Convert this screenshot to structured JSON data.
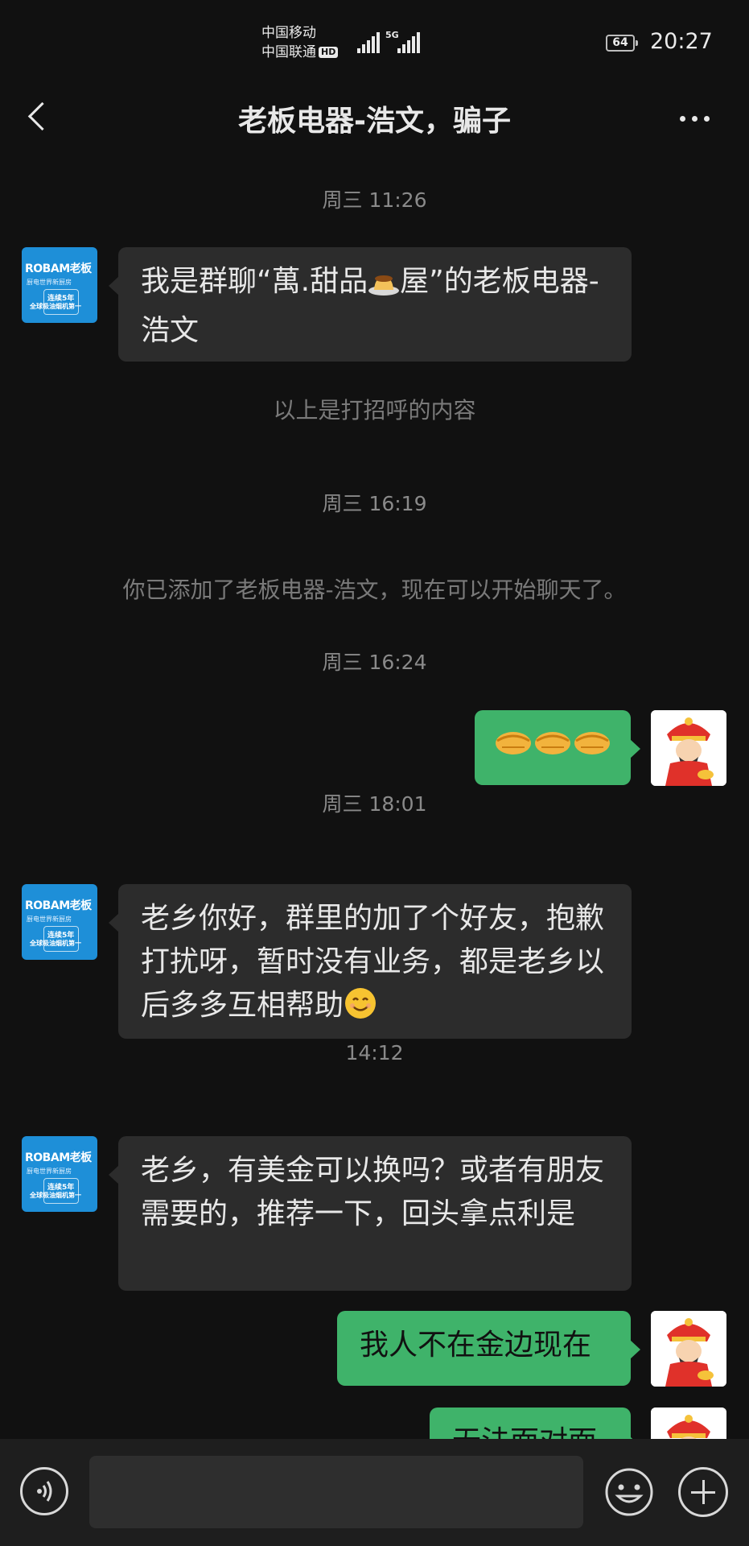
{
  "status_bar": {
    "carrier_1": "中国移动",
    "carrier_2": "中国联通",
    "hd_badge": "HD",
    "network": "5G",
    "battery": "64",
    "time": "20:27"
  },
  "header": {
    "title": "老板电器-浩文，骗子"
  },
  "messages": [
    {
      "type": "time",
      "text": "周三 11:26"
    },
    {
      "type": "incoming",
      "sender": "老板电器-浩文",
      "parts": [
        "我是群聊“萬.甜品",
        "屋”的老板电器-浩文"
      ],
      "inline_emoji": "pudding-emoji"
    },
    {
      "type": "system",
      "text": "以上是打招呼的内容"
    },
    {
      "type": "time",
      "text": "周三 16:19"
    },
    {
      "type": "system",
      "text": "你已添加了老板电器-浩文，现在可以开始聊天了。"
    },
    {
      "type": "time",
      "text": "周三 16:24"
    },
    {
      "type": "outgoing",
      "emoji": [
        "handshake-emoji",
        "handshake-emoji",
        "handshake-emoji"
      ]
    },
    {
      "type": "time",
      "text": "周三 18:01"
    },
    {
      "type": "incoming",
      "sender": "老板电器-浩文",
      "text": "老乡你好，群里的加了个好友，抱歉打扰呀，暂时没有业务，都是老乡以后多多互相帮助",
      "trailing_emoji": "smile-emoji"
    },
    {
      "type": "time",
      "text": "14:12"
    },
    {
      "type": "incoming",
      "sender": "老板电器-浩文",
      "text": "老乡，有美金可以换吗？或者有朋友需要的，推荐一下，回头拿点利是"
    },
    {
      "type": "outgoing",
      "text": "我人不在金边现在"
    },
    {
      "type": "outgoing",
      "text": "无法面对面"
    }
  ],
  "avatars": {
    "contact": {
      "brand": "ROBAM老板",
      "tagline": "厨电世界新厨房",
      "badge": "连续5年",
      "sub": "全球吸油烟机第一"
    },
    "self": "god-of-wealth-avatar"
  },
  "input_bar": {
    "placeholder": ""
  },
  "colors": {
    "background": "#111111",
    "incoming_bubble": "#2c2c2c",
    "outgoing_bubble": "#3fb36a",
    "avatar_blue": "#1e8fd8"
  }
}
